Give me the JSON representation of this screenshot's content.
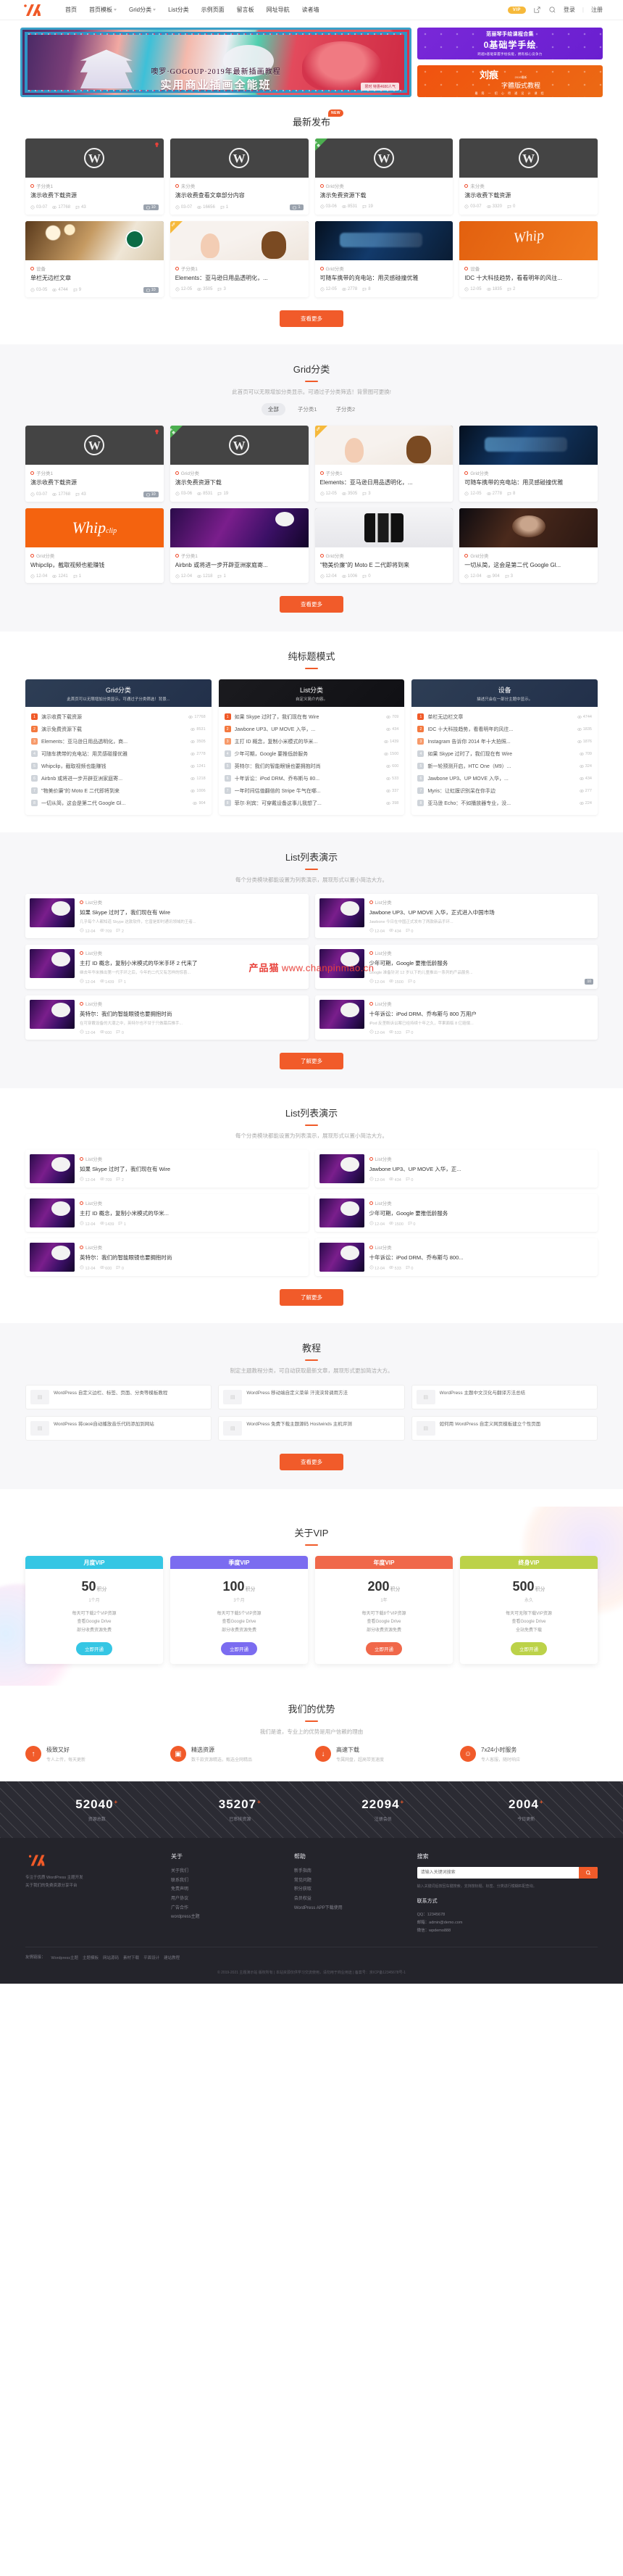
{
  "header": {
    "logo_name": "site-logo",
    "nav": [
      {
        "label": "首页",
        "dropdown": false
      },
      {
        "label": "首页模板",
        "dropdown": true
      },
      {
        "label": "Grid分类",
        "dropdown": true
      },
      {
        "label": "List分类",
        "dropdown": false
      },
      {
        "label": "示例页面",
        "dropdown": false
      },
      {
        "label": "留言板",
        "dropdown": false
      },
      {
        "label": "网址导航",
        "dropdown": false
      },
      {
        "label": "读者墙",
        "dropdown": false
      }
    ],
    "vip_badge": "VIP",
    "login": "登录",
    "separator": "|",
    "register": "注册"
  },
  "hero": {
    "title": "噢罗·GOGOUP·2019年最新插画教程",
    "subtitle": "实用商业插画全能班",
    "badge": "限时 特惠4680人气",
    "ads": [
      {
        "line1": "范丽琴手绘课程合集",
        "line2": "0基础学手绘",
        "line3": "跨越0基础掌握手绘技能，拥有核心竞争力"
      },
      {
        "big": "刘痕",
        "small": "字體版式教程",
        "top": "2019最新",
        "tiny": "最 简 一 招 心 得 通 设 计 课 程"
      }
    ]
  },
  "latest": {
    "title": "最新发布",
    "badge": "NEW",
    "cards": [
      {
        "cat": "子分类1",
        "title": "演示收费下载资源",
        "date": "03-07",
        "views": "17768",
        "comments": "43",
        "price": "10",
        "thumb": "wp",
        "flag": "hot"
      },
      {
        "cat": "未分类",
        "title": "演示收费查看文章部分内容",
        "date": "03-07",
        "views": "16656",
        "comments": "1",
        "price": "1",
        "thumb": "wp",
        "flag": ""
      },
      {
        "cat": "Grid分类",
        "title": "演示免费资源下载",
        "date": "03-06",
        "views": "8531",
        "comments": "19",
        "price": "",
        "thumb": "wp",
        "flag": "free"
      },
      {
        "cat": "未分类",
        "title": "演示收费下载资源",
        "date": "03-07",
        "views": "3320",
        "comments": "0",
        "price": "",
        "thumb": "wp",
        "flag": ""
      },
      {
        "cat": "设备",
        "title": "单栏无边栏文章",
        "date": "03-05",
        "views": "4744",
        "comments": "9",
        "price": "10",
        "thumb": "coffee",
        "flag": ""
      },
      {
        "cat": "子分类1",
        "title": "Elements：亚马逊日用品透明化，...",
        "date": "12-05",
        "views": "3505",
        "comments": "3",
        "price": "",
        "thumb": "baby",
        "flag": "vip"
      },
      {
        "cat": "Grid分类",
        "title": "可随车携带的充电站：用灵感碰撞优雅",
        "date": "12-05",
        "views": "2778",
        "comments": "8",
        "price": "",
        "thumb": "car",
        "flag": ""
      },
      {
        "cat": "设备",
        "title": "IDC 十大科技趋势，看看明年的风往...",
        "date": "12-05",
        "views": "1835",
        "comments": "2",
        "price": "",
        "thumb": "idc",
        "flag": ""
      }
    ],
    "more": "查看更多"
  },
  "gridsec": {
    "title": "Grid分类",
    "desc": "此首页可以无限增加分类显示。可通过子分类筛选！背景图可更换!",
    "tabs": [
      {
        "label": "全部",
        "active": true
      },
      {
        "label": "子分类1",
        "active": false
      },
      {
        "label": "子分类2",
        "active": false
      }
    ],
    "cards": [
      {
        "cat": "子分类1",
        "title": "演示收费下载资源",
        "date": "03-07",
        "views": "17768",
        "comments": "43",
        "price": "10",
        "thumb": "wp",
        "flag": "hot"
      },
      {
        "cat": "Grid分类",
        "title": "演示免费资源下载",
        "date": "03-06",
        "views": "8531",
        "comments": "19",
        "price": "",
        "thumb": "wp",
        "flag": "free"
      },
      {
        "cat": "子分类1",
        "title": "Elements：亚马逊日用品透明化，...",
        "date": "12-05",
        "views": "3505",
        "comments": "3",
        "price": "",
        "thumb": "baby",
        "flag": "vip"
      },
      {
        "cat": "Grid分类",
        "title": "可随车携带的充电站：用灵感碰撞优雅",
        "date": "12-05",
        "views": "2778",
        "comments": "8",
        "price": "",
        "thumb": "car",
        "flag": ""
      },
      {
        "cat": "Grid分类",
        "title": "Whipclip，截取视频也能赚钱",
        "date": "12-04",
        "views": "1241",
        "comments": "1",
        "price": "",
        "thumb": "whip",
        "flag": ""
      },
      {
        "cat": "子分类1",
        "title": "Airbnb 或将进一步开辟亚洲家庭寄...",
        "date": "12-04",
        "views": "1218",
        "comments": "1",
        "price": "",
        "thumb": "stage",
        "flag": ""
      },
      {
        "cat": "Grid分类",
        "title": "\"物美价廉\"的 Moto E 二代即将到来",
        "date": "12-04",
        "views": "1006",
        "comments": "0",
        "price": "",
        "thumb": "phone",
        "flag": ""
      },
      {
        "cat": "Grid分类",
        "title": "一切从简，这会是第二代 Google Gl...",
        "date": "12-04",
        "views": "904",
        "comments": "3",
        "price": "",
        "thumb": "iron",
        "flag": ""
      }
    ],
    "more": "查看更多"
  },
  "titlemode": {
    "title": "纯标题模式",
    "columns": [
      {
        "head": "Grid分类",
        "desc": "此首页可以无限增加分类显示。可通过子分类筛选！背景...",
        "dark": false,
        "rows": [
          {
            "title": "演示收费下载资源",
            "views": "17768"
          },
          {
            "title": "演示免费资源下载",
            "views": "8531"
          },
          {
            "title": "Elements：亚马逊日用品透明化，商...",
            "views": "3505"
          },
          {
            "title": "可随车携带的充电站：用灵感碰撞优雅",
            "views": "2778"
          },
          {
            "title": "Whipclip，截取视频也能赚钱",
            "views": "1241"
          },
          {
            "title": "Airbnb 或将进一步开辟亚洲家庭寄...",
            "views": "1218"
          },
          {
            "title": "\"物美价廉\"的 Moto E 二代即将到来",
            "views": "1006"
          },
          {
            "title": "一切从简，这会是第二代 Google Gl...",
            "views": "904"
          }
        ]
      },
      {
        "head": "List分类",
        "desc": "自定义简介内容。",
        "dark": true,
        "rows": [
          {
            "title": "如果 Skype 过时了，我们现在有 Wire",
            "views": "709"
          },
          {
            "title": "Jawbone UP3、UP MOVE 入华，...",
            "views": "434"
          },
          {
            "title": "主打 ID 概念，复制小米模式的华米...",
            "views": "1439"
          },
          {
            "title": "少年可期，Google 要推低龄服务",
            "views": "1500"
          },
          {
            "title": "英特尔：我们的智能眼镜也要拥抱时尚",
            "views": "600"
          },
          {
            "title": "十年诉讼：iPod DRM、乔布斯与 80...",
            "views": "533"
          },
          {
            "title": "一年时间估值翻倍的 Stripe 牛气在哪...",
            "views": "337"
          },
          {
            "title": "菲尔·利宾：可穿戴设备这事儿我想了...",
            "views": "398"
          }
        ]
      },
      {
        "head": "设备",
        "desc": "描述只会在一部分主题中显示。",
        "dark": false,
        "rows": [
          {
            "title": "单栏无边栏文章",
            "views": "4744"
          },
          {
            "title": "IDC 十大科技趋势，看看明年的风往...",
            "views": "1835"
          },
          {
            "title": "Instagram 告诉你 2014 年十大拍照...",
            "views": "1876"
          },
          {
            "title": "如果 Skype 过时了，我们现在有 Wire",
            "views": "709"
          },
          {
            "title": "新一轮预测开启，HTC One（M9）...",
            "views": "324"
          },
          {
            "title": "Jawbone UP3、UP MOVE 入华，...",
            "views": "434"
          },
          {
            "title": "Myris：让虹膜识别呆在你手边",
            "views": "277"
          },
          {
            "title": "亚马逊 Echo：不如播放器专业，没...",
            "views": "224"
          }
        ]
      }
    ]
  },
  "listdemo1": {
    "title": "List列表演示",
    "desc": "每个分类模块都能设置为列表演示，展现形式以置小简洁大方。",
    "rows": [
      {
        "cat": "List分类",
        "title": "如果 Skype 过时了，我们现在有 Wire",
        "desc": "几乎每个人都知道 Skype 这款软件，它曾是即时通讯领域的王者...",
        "date": "12-04",
        "views": "709",
        "comments": "2",
        "thumb": "stage",
        "price": ""
      },
      {
        "cat": "List分类",
        "title": "Jawbone UP3、UP MOVE 入华，正式进入中国市场",
        "desc": "Jawbone 今日在中国正式发布了两款新品手环...",
        "date": "12-04",
        "views": "434",
        "comments": "0",
        "thumb": "band",
        "price": ""
      },
      {
        "cat": "List分类",
        "title": "主打 ID 概念，复制小米模式的华米手环 2 代来了",
        "desc": "继去年华米推出第一代手环之后，今年的二代又有怎样的惊喜...",
        "date": "12-04",
        "views": "1439",
        "comments": "1",
        "thumb": "band2",
        "price": ""
      },
      {
        "cat": "List分类",
        "title": "少年可期，Google 要推低龄服务",
        "desc": "Google 准备针对 12 岁以下的儿童推出一系列的产品服务...",
        "date": "12-04",
        "views": "1500",
        "comments": "0",
        "thumb": "kid",
        "price": "10"
      },
      {
        "cat": "List分类",
        "title": "英特尔：我们的智能眼镜也要拥抱时尚",
        "desc": "在可穿戴设备的大潮之中，英特尔也不甘于只做幕后推手...",
        "date": "12-04",
        "views": "600",
        "comments": "0",
        "thumb": "glass",
        "price": ""
      },
      {
        "cat": "List分类",
        "title": "十年诉讼：iPod DRM、乔布斯与 800 万用户",
        "desc": "iPod 反垄断诉讼案已经持续十年之久，苹果面临 8 亿赔偿...",
        "date": "12-04",
        "views": "533",
        "comments": "0",
        "thumb": "ipod",
        "price": ""
      }
    ],
    "more": "了解更多"
  },
  "listdemo2": {
    "title": "List列表演示",
    "desc": "每个分类模块都能设置为列表演示，展现形式以置小简洁大方。",
    "rows": [
      {
        "cat": "List分类",
        "title": "如果 Skype 过时了，我们现在有 Wire",
        "date": "12-04",
        "views": "709",
        "comments": "2",
        "thumb": "stage"
      },
      {
        "cat": "List分类",
        "title": "Jawbone UP3、UP MOVE 入华，正...",
        "date": "12-04",
        "views": "434",
        "comments": "0",
        "thumb": "band"
      },
      {
        "cat": "List分类",
        "title": "主打 ID 概念，复制小米模式的华米...",
        "date": "12-04",
        "views": "1439",
        "comments": "1",
        "thumb": "band2"
      },
      {
        "cat": "List分类",
        "title": "少年可期，Google 要推低龄服务",
        "date": "12-04",
        "views": "1500",
        "comments": "0",
        "thumb": "kid"
      },
      {
        "cat": "List分类",
        "title": "英特尔：我们的智能眼镜也要拥抱时尚",
        "date": "12-04",
        "views": "600",
        "comments": "0",
        "thumb": "glass"
      },
      {
        "cat": "List分类",
        "title": "十年诉讼：iPod DRM、乔布斯与 800...",
        "date": "12-04",
        "views": "533",
        "comments": "0",
        "thumb": "ipod"
      }
    ],
    "more": "了解更多"
  },
  "tutorial": {
    "title": "教程",
    "desc": "制定主题教程分类，可自动获取最新文章，展现形式更加简洁大方。",
    "items": [
      {
        "text": "WordPress 自定义边栏、标签、页面、分类等模板教程"
      },
      {
        "text": "WordPress 移动端自定义菜单 汗流浃背调用方法"
      },
      {
        "text": "WordPress 主题中文汉化与翻译方法总结"
      },
      {
        "text": "WordPress 将своё自动播放音乐代码添加到网站"
      },
      {
        "text": "WordPress 免费下载主题源码 Hostwinds 主机评测"
      },
      {
        "text": "如何用 WordPress 自定义网页模板建立个性页面"
      }
    ],
    "more": "查看更多"
  },
  "vip": {
    "title": "关于VIP",
    "plans": [
      {
        "name": "月度VIP",
        "color": "#35c6e4",
        "price": "50",
        "unit": "积分",
        "period": "1个月",
        "features": "每天可下载2个VIP资源\n查看Google Drive\n部分收费资源免费",
        "btn": "立即开通",
        "btncolor": "#35c6e4"
      },
      {
        "name": "季度VIP",
        "color": "#7b6cf0",
        "price": "100",
        "unit": "积分",
        "period": "3个月",
        "features": "每天可下载5个VIP资源\n查看Google Drive\n部分收费资源免费",
        "btn": "立即开通",
        "btncolor": "#7b6cf0"
      },
      {
        "name": "年度VIP",
        "color": "#f0684a",
        "price": "200",
        "unit": "积分",
        "period": "1年",
        "features": "每天可下载8个VIP资源\n查看Google Drive\n部分收费资源免费",
        "btn": "立即开通",
        "btncolor": "#f0684a"
      },
      {
        "name": "终身VIP",
        "color": "#bcd249",
        "price": "500",
        "unit": "积分",
        "period": "永久",
        "features": "每天可无限下载VIP资源\n查看Google Drive\n全站免费下载",
        "btn": "立即开通",
        "btncolor": "#bcd249"
      }
    ]
  },
  "advantages": {
    "title": "我们的优势",
    "desc": "我们是谁，专业上的优势是用户信赖的理由",
    "items": [
      {
        "icon": "↑",
        "title": "极致又好",
        "desc": "专人上传，每天更新"
      },
      {
        "icon": "▣",
        "title": "精选资源",
        "desc": "数千款资源精选，甄选全网精品"
      },
      {
        "icon": "↓",
        "title": "高速下载",
        "desc": "专属网盘，超高带宽速度"
      },
      {
        "icon": "☺",
        "title": "7x24小时服务",
        "desc": "专人客服，随时响应"
      }
    ]
  },
  "counters": [
    {
      "num": "52040",
      "sup": "+",
      "label": "资源总数"
    },
    {
      "num": "35207",
      "sup": "+",
      "label": "已审核资源"
    },
    {
      "num": "22094",
      "sup": "+",
      "label": "注册会员"
    },
    {
      "num": "2004",
      "sup": "+",
      "label": "今日更新"
    }
  ],
  "footer": {
    "brand_desc": "专注于优质 WordPress 主题开发\n关于我们的免费资源分享平台",
    "col_about": {
      "title": "关于",
      "links": [
        "关于我们",
        "联系我们",
        "免责声明",
        "用户协议",
        "广告合作",
        "wordpress主题"
      ]
    },
    "col_help": {
      "title": "帮助",
      "links": [
        "新手指南",
        "常见问题",
        "积分获取",
        "会员权益",
        "WordPress APP下载使用"
      ]
    },
    "search": {
      "title": "搜索",
      "placeholder": "请输入关键词搜索",
      "button": "搜索",
      "note": "输入关键词后按回车键搜索，支持按标题、标签、分类进行模糊匹配查询。",
      "contact_title": "联系方式",
      "contacts": [
        "QQ：12345678",
        "邮箱：admin@demo.com",
        "微信：wpdemo888"
      ]
    },
    "tags_title": "友情链接：",
    "tags": [
      "Wordpress主题",
      "主题模板",
      "网站源码",
      "素材下载",
      "平面设计",
      "建站教程"
    ],
    "copyright": "© 2019-2021 主题演示站 版权所有 | 本站资源仅供学习交流使用，请勿用于商业用途 | 备案号：京ICP备12345678号-1"
  }
}
